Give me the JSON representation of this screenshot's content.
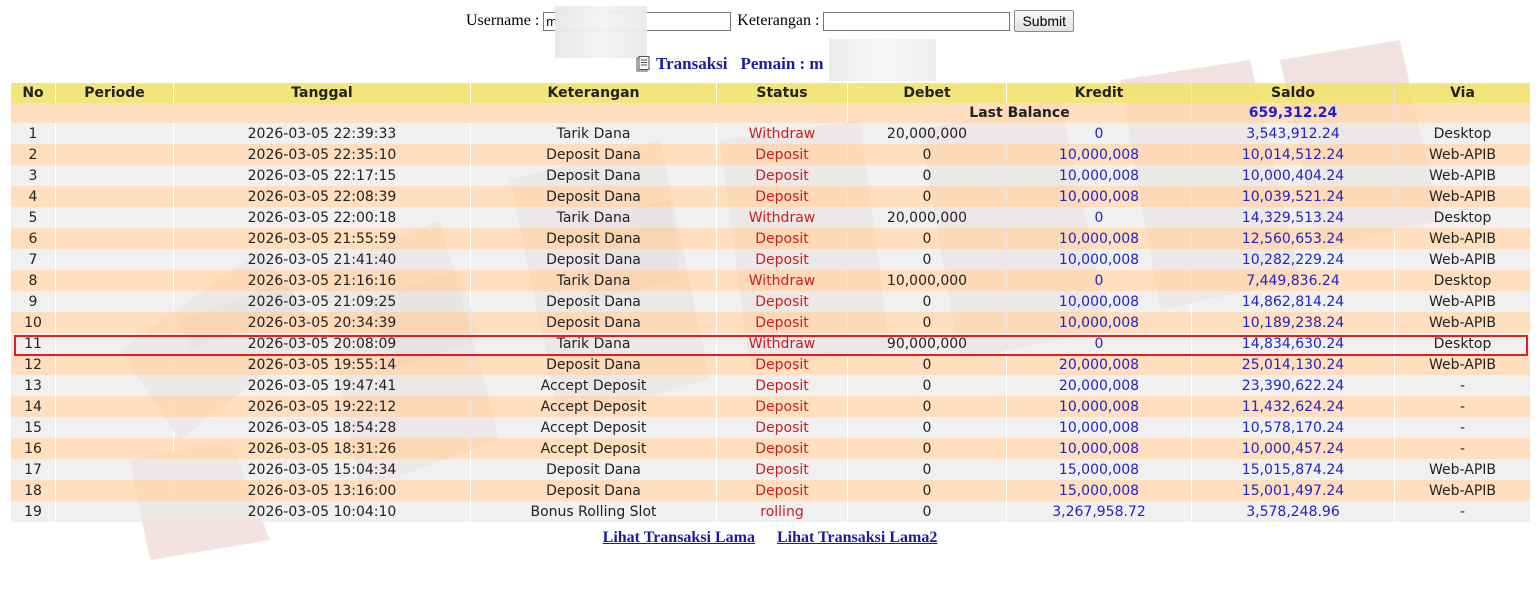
{
  "search": {
    "username_label": "Username :",
    "username_value": "m",
    "keterangan_label": "Keterangan :",
    "keterangan_value": "",
    "submit_label": "Submit"
  },
  "heading": {
    "icon": "document-icon",
    "transaksi": "Transaksi",
    "pemain": "Pemain : m"
  },
  "table": {
    "columns": [
      "No",
      "Periode",
      "Tanggal",
      "Keterangan",
      "Status",
      "Debet",
      "Kredit",
      "Saldo",
      "Via"
    ],
    "last_balance_label": "Last Balance",
    "last_balance_value": "659,312.24",
    "highlighted_row": 11,
    "rows": [
      {
        "no": "1",
        "periode": "",
        "tanggal": "2026-03-05 22:39:33",
        "keterangan": "Tarik Dana",
        "status": "Withdraw",
        "debet": "20,000,000",
        "kredit": "0",
        "saldo": "3,543,912.24",
        "via": "Desktop"
      },
      {
        "no": "2",
        "periode": "",
        "tanggal": "2026-03-05 22:35:10",
        "keterangan": "Deposit Dana",
        "status": "Deposit",
        "debet": "0",
        "kredit": "10,000,008",
        "saldo": "10,014,512.24",
        "via": "Web-APIB"
      },
      {
        "no": "3",
        "periode": "",
        "tanggal": "2026-03-05 22:17:15",
        "keterangan": "Deposit Dana",
        "status": "Deposit",
        "debet": "0",
        "kredit": "10,000,008",
        "saldo": "10,000,404.24",
        "via": "Web-APIB"
      },
      {
        "no": "4",
        "periode": "",
        "tanggal": "2026-03-05 22:08:39",
        "keterangan": "Deposit Dana",
        "status": "Deposit",
        "debet": "0",
        "kredit": "10,000,008",
        "saldo": "10,039,521.24",
        "via": "Web-APIB"
      },
      {
        "no": "5",
        "periode": "",
        "tanggal": "2026-03-05 22:00:18",
        "keterangan": "Tarik Dana",
        "status": "Withdraw",
        "debet": "20,000,000",
        "kredit": "0",
        "saldo": "14,329,513.24",
        "via": "Desktop"
      },
      {
        "no": "6",
        "periode": "",
        "tanggal": "2026-03-05 21:55:59",
        "keterangan": "Deposit Dana",
        "status": "Deposit",
        "debet": "0",
        "kredit": "10,000,008",
        "saldo": "12,560,653.24",
        "via": "Web-APIB"
      },
      {
        "no": "7",
        "periode": "",
        "tanggal": "2026-03-05 21:41:40",
        "keterangan": "Deposit Dana",
        "status": "Deposit",
        "debet": "0",
        "kredit": "10,000,008",
        "saldo": "10,282,229.24",
        "via": "Web-APIB"
      },
      {
        "no": "8",
        "periode": "",
        "tanggal": "2026-03-05 21:16:16",
        "keterangan": "Tarik Dana",
        "status": "Withdraw",
        "debet": "10,000,000",
        "kredit": "0",
        "saldo": "7,449,836.24",
        "via": "Desktop"
      },
      {
        "no": "9",
        "periode": "",
        "tanggal": "2026-03-05 21:09:25",
        "keterangan": "Deposit Dana",
        "status": "Deposit",
        "debet": "0",
        "kredit": "10,000,008",
        "saldo": "14,862,814.24",
        "via": "Web-APIB"
      },
      {
        "no": "10",
        "periode": "",
        "tanggal": "2026-03-05 20:34:39",
        "keterangan": "Deposit Dana",
        "status": "Deposit",
        "debet": "0",
        "kredit": "10,000,008",
        "saldo": "10,189,238.24",
        "via": "Web-APIB"
      },
      {
        "no": "11",
        "periode": "",
        "tanggal": "2026-03-05 20:08:09",
        "keterangan": "Tarik Dana",
        "status": "Withdraw",
        "debet": "90,000,000",
        "kredit": "0",
        "saldo": "14,834,630.24",
        "via": "Desktop"
      },
      {
        "no": "12",
        "periode": "",
        "tanggal": "2026-03-05 19:55:14",
        "keterangan": "Deposit Dana",
        "status": "Deposit",
        "debet": "0",
        "kredit": "20,000,008",
        "saldo": "25,014,130.24",
        "via": "Web-APIB"
      },
      {
        "no": "13",
        "periode": "",
        "tanggal": "2026-03-05 19:47:41",
        "keterangan": "Accept Deposit",
        "status": "Deposit",
        "debet": "0",
        "kredit": "20,000,008",
        "saldo": "23,390,622.24",
        "via": "-"
      },
      {
        "no": "14",
        "periode": "",
        "tanggal": "2026-03-05 19:22:12",
        "keterangan": "Accept Deposit",
        "status": "Deposit",
        "debet": "0",
        "kredit": "10,000,008",
        "saldo": "11,432,624.24",
        "via": "-"
      },
      {
        "no": "15",
        "periode": "",
        "tanggal": "2026-03-05 18:54:28",
        "keterangan": "Accept Deposit",
        "status": "Deposit",
        "debet": "0",
        "kredit": "10,000,008",
        "saldo": "10,578,170.24",
        "via": "-"
      },
      {
        "no": "16",
        "periode": "",
        "tanggal": "2026-03-05 18:31:26",
        "keterangan": "Accept Deposit",
        "status": "Deposit",
        "debet": "0",
        "kredit": "10,000,008",
        "saldo": "10,000,457.24",
        "via": "-"
      },
      {
        "no": "17",
        "periode": "",
        "tanggal": "2026-03-05 15:04:34",
        "keterangan": "Deposit Dana",
        "status": "Deposit",
        "debet": "0",
        "kredit": "15,000,008",
        "saldo": "15,015,874.24",
        "via": "Web-APIB"
      },
      {
        "no": "18",
        "periode": "",
        "tanggal": "2026-03-05 13:16:00",
        "keterangan": "Deposit Dana",
        "status": "Deposit",
        "debet": "0",
        "kredit": "15,000,008",
        "saldo": "15,001,497.24",
        "via": "Web-APIB"
      },
      {
        "no": "19",
        "periode": "",
        "tanggal": "2026-03-05 10:04:10",
        "keterangan": "Bonus Rolling Slot",
        "status": "rolling",
        "debet": "0",
        "kredit": "3,267,958.72",
        "saldo": "3,578,248.96",
        "via": "-"
      }
    ]
  },
  "links": {
    "lama": "Lihat Transaksi Lama",
    "lama2": "Lihat Transaksi Lama2"
  },
  "colors": {
    "header_bg": "#f1e36e",
    "row_odd": "#eaeaea",
    "row_even": "#ffd6aa",
    "status_red": "#d11c1c",
    "amount_blue": "#2323c8",
    "highlight_border": "#e02020",
    "link_blue": "#1a1aa6"
  }
}
